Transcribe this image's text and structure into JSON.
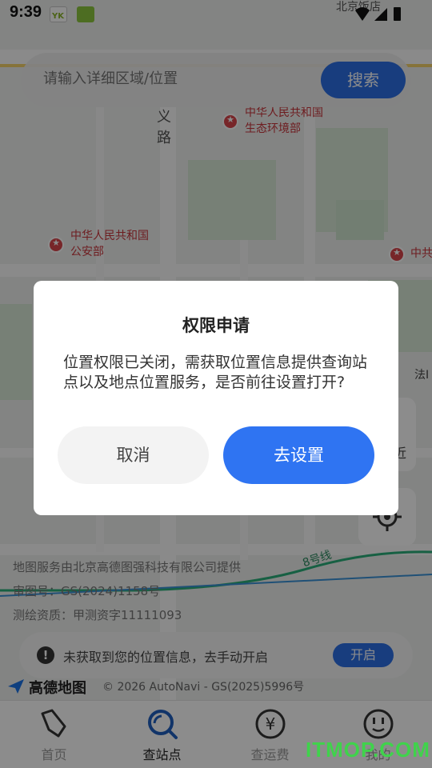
{
  "status_bar": {
    "time": "9:39",
    "icons": [
      "app-yk-icon",
      "app-green-icon",
      "wifi-icon",
      "signal-icon",
      "battery-icon"
    ]
  },
  "search": {
    "placeholder": "请输入详细区域/位置",
    "button_label": "搜索"
  },
  "map": {
    "labels": {
      "road_top": "义",
      "road_bottom": "路",
      "poi_1_line1": "中华人民共和国",
      "poi_1_line2": "生态环境部",
      "poi_2_line1": "中华人民共和国",
      "poi_2_line2": "公安部",
      "poi_3": "中共",
      "poi_4": "法I",
      "poi_top": "北京饭店",
      "line_label": "8号线"
    },
    "credits": {
      "line1": "地图服务由北京高德图强科技有限公司提供",
      "line2": "审图号：GS(2024)1158号",
      "line3": "测绘资质：甲测资字11111093"
    },
    "brand": "高德地图",
    "copyright": "© 2026 AutoNavi - GS(2025)5996号",
    "side_button_label": "近"
  },
  "location_notice": {
    "text": "未获取到您的位置信息，去手动开启",
    "button_label": "开启"
  },
  "dialog": {
    "title": "权限申请",
    "body": "位置权限已关闭，需获取位置信息提供查询站点以及地点位置服务，是否前往设置打开?",
    "cancel_label": "取消",
    "confirm_label": "去设置"
  },
  "tabbar": {
    "tabs": [
      {
        "label": "首页",
        "icon": "home-icon"
      },
      {
        "label": "查站点",
        "icon": "search-station-icon"
      },
      {
        "label": "查运费",
        "icon": "yen-icon"
      },
      {
        "label": "我的",
        "icon": "smiley-icon"
      }
    ],
    "active_index": 1
  },
  "watermark": "ITMOP.COM",
  "colors": {
    "primary": "#2f74f2",
    "overlay": "rgba(0,0,0,0.45)",
    "poi_red": "#d9454b",
    "watermark": "#3fd34b"
  }
}
